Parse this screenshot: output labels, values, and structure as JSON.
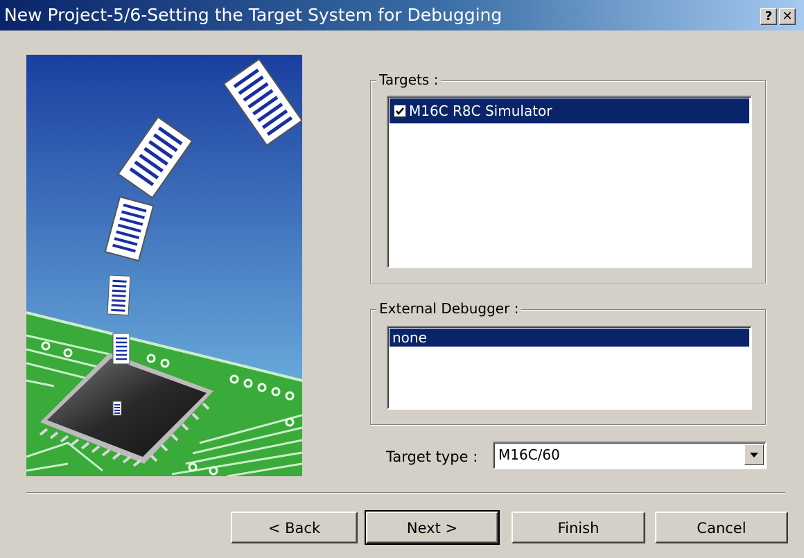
{
  "window": {
    "title": "New Project-5/6-Setting the Target System for Debugging",
    "help_label": "?",
    "close_label": "✕"
  },
  "targets": {
    "group_label": "Targets :",
    "items": [
      {
        "label": "M16C R8C Simulator",
        "checked": true,
        "selected": true
      }
    ]
  },
  "external_debugger": {
    "group_label": "External Debugger :",
    "items": [
      {
        "label": "none",
        "selected": true
      }
    ]
  },
  "target_type": {
    "label": "Target type :",
    "value": "M16C/60"
  },
  "buttons": {
    "back": "< Back",
    "next": "Next >",
    "finish": "Finish",
    "cancel": "Cancel"
  },
  "colors": {
    "selection": "#0a246a",
    "face": "#d4d0c8",
    "sky_top": "#1a3fa0",
    "sky_bottom": "#7ec6ea",
    "board": "#3aaa3a"
  }
}
